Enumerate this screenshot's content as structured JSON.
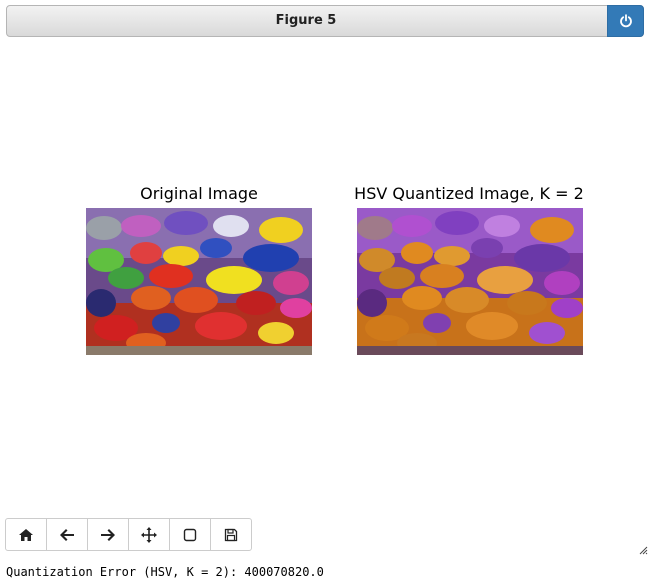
{
  "window": {
    "title": "Figure 5",
    "power_icon": "power-icon"
  },
  "figure": {
    "subplots": [
      {
        "title": "Original Image"
      },
      {
        "title": "HSV Quantized Image, K = 2"
      }
    ]
  },
  "toolbar": {
    "buttons": [
      {
        "icon": "home-icon"
      },
      {
        "icon": "arrow-left-icon"
      },
      {
        "icon": "arrow-right-icon"
      },
      {
        "icon": "move-icon"
      },
      {
        "icon": "zoom-rect-icon"
      },
      {
        "icon": "save-icon"
      }
    ]
  },
  "status": {
    "text": "Quantization Error (HSV, K = 2): 400070820.0"
  },
  "colors": {
    "accent": "#337ab7"
  }
}
